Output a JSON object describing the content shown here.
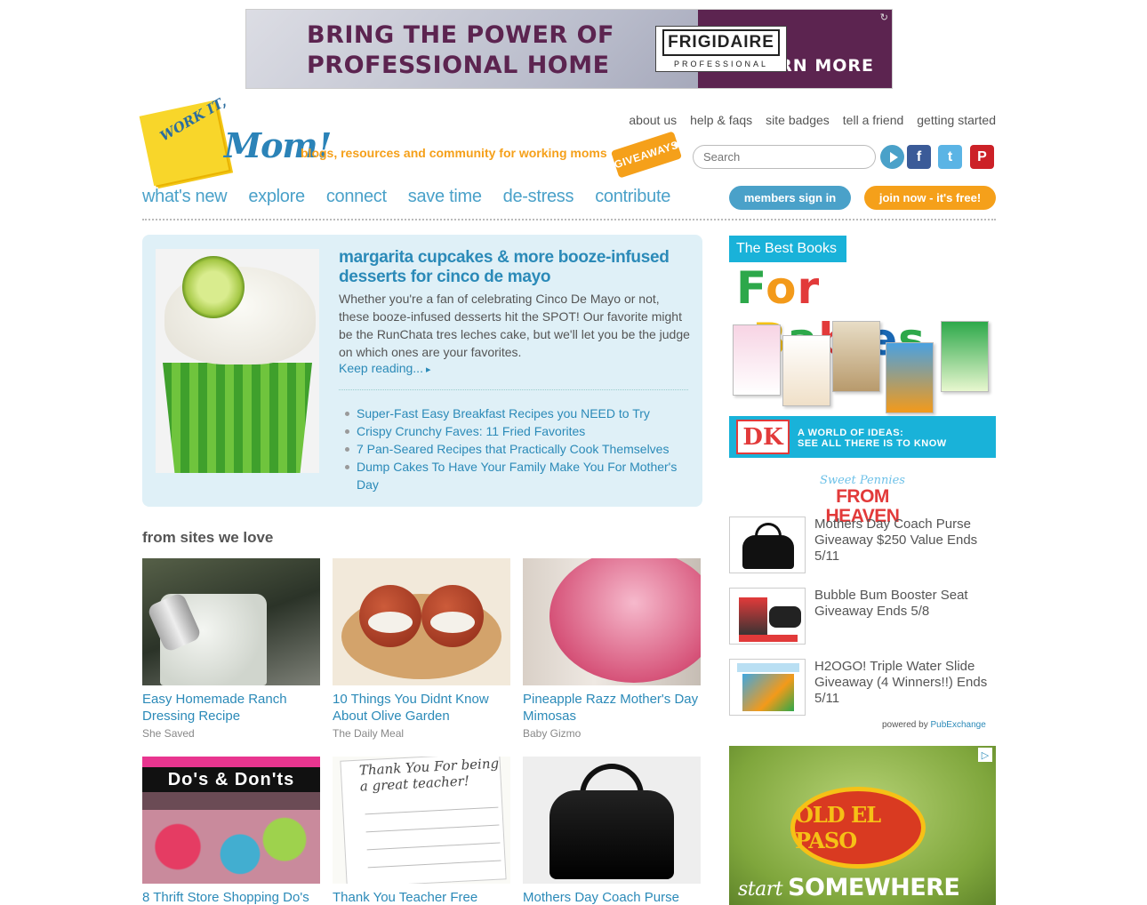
{
  "top_ad": {
    "headline_line1": "BRING THE POWER OF",
    "headline_line2": "PROFESSIONAL HOME",
    "brand": "FRIGIDAIRE",
    "brand_sub": "PROFESSIONAL",
    "cta": "LEARN MORE"
  },
  "header": {
    "logo_note": "WORK IT,",
    "logo_mom": "Mom!",
    "tagline": "blogs, resources and community for working moms",
    "giveaways": "GIVEAWAYS",
    "search_placeholder": "Search",
    "util_nav": [
      "about us",
      "help & faqs",
      "site badges",
      "tell a friend",
      "getting started"
    ],
    "social": {
      "facebook": "f",
      "twitter": "t",
      "pinterest": "P"
    }
  },
  "main_nav": [
    "what's new",
    "explore",
    "connect",
    "save time",
    "de-stress",
    "contribute"
  ],
  "account": {
    "sign_in": "members sign in",
    "join": "join now - it's free!"
  },
  "featured": {
    "title": "margarita cupcakes & more booze-infused desserts for cinco de mayo",
    "description": "Whether you're a fan of celebrating Cinco De Mayo or not, these booze-infused desserts hit the SPOT! Our favorite might be the RunChata tres leches cake, but we'll let you be the judge on which ones are your favorites.",
    "more": "Keep reading...",
    "links": [
      "Super-Fast Easy Breakfast Recipes you NEED to Try",
      "Crispy Crunchy Faves: 11 Fried Favorites",
      "7 Pan-Seared Recipes that Practically Cook Themselves",
      "Dump Cakes To Have Your Family Make You For Mother's Day"
    ]
  },
  "sites_we_love": {
    "heading": "from sites we love",
    "cards": [
      {
        "title": "Easy Homemade Ranch Dressing Recipe",
        "source": "She Saved"
      },
      {
        "title": "10 Things You Didnt Know About Olive Garden",
        "source": "The Daily Meal"
      },
      {
        "title": "Pineapple Razz Mother's Day Mimosas",
        "source": "Baby Gizmo"
      },
      {
        "title": "8 Thrift Store Shopping Do's",
        "source": ""
      },
      {
        "title": "Thank You Teacher Free",
        "source": ""
      },
      {
        "title": "Mothers Day Coach Purse",
        "source": ""
      }
    ],
    "thrift_overlay": "Do's & Don'ts",
    "thank_overlay": "Thank You For being a great teacher!"
  },
  "sidebar": {
    "books_ad": {
      "best": "The Best Books",
      "for_babies": [
        "F",
        "o",
        "r",
        " ",
        "B",
        "a",
        "b",
        "i",
        "e",
        "s"
      ],
      "footer_line1": "A WORLD OF IDEAS:",
      "footer_line2": "SEE ALL THERE IS TO KNOW",
      "brand": "DK"
    },
    "partner_logo": {
      "line1": "Sweet Pennies",
      "line2": "FROM HEAVEN"
    },
    "partner_items": [
      "Mothers Day Coach Purse Giveaway $250 Value Ends 5/11",
      "Bubble Bum Booster Seat Giveaway Ends 5/8",
      "H2OGO! Triple Water Slide Giveaway (4 Winners!!) Ends 5/11"
    ],
    "powered_by": "powered by",
    "powered_brand": "PubExchange",
    "oep_ad": {
      "brand": "OLD EL PASO",
      "slogan_script": "start",
      "slogan": "SOMEWHERE FRESH"
    }
  }
}
